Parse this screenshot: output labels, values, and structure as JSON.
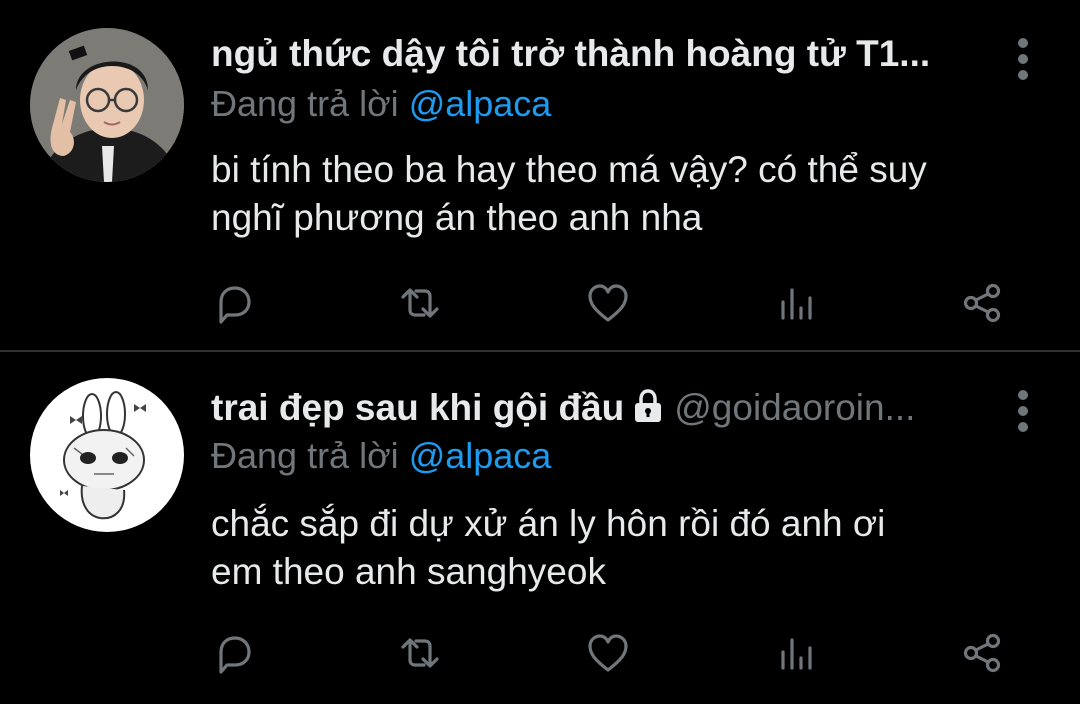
{
  "tweets": [
    {
      "display_name": "ngủ thức dậy tôi trở thành hoàng tử T1...",
      "handle": "",
      "replying_prefix": "Đang trả lời",
      "replying_to": "@alpaca",
      "text_line1": "bi tính theo ba hay theo má vậy? có thể suy",
      "text_line2": "nghĩ phương án theo anh nha",
      "avatar_icon": "avatar-photo-icon",
      "protected": false
    },
    {
      "display_name": "trai đẹp sau khi gội đầu",
      "handle": "@goidaoroin...",
      "replying_prefix": "Đang trả lời",
      "replying_to": "@alpaca",
      "text_line1": "chắc sắp đi dự xử án ly hôn rồi đó anh ơi",
      "text_line2": "em theo anh sanghyeok",
      "avatar_icon": "bunny-sketch-avatar-icon",
      "protected": true
    }
  ],
  "colors": {
    "background": "#000000",
    "text_primary": "#e7e9ea",
    "text_secondary": "#71767b",
    "accent": "#1d9bf0",
    "divider": "#2f3336"
  },
  "action_icons": [
    "reply-icon",
    "retweet-icon",
    "like-icon",
    "analytics-icon",
    "share-icon"
  ]
}
